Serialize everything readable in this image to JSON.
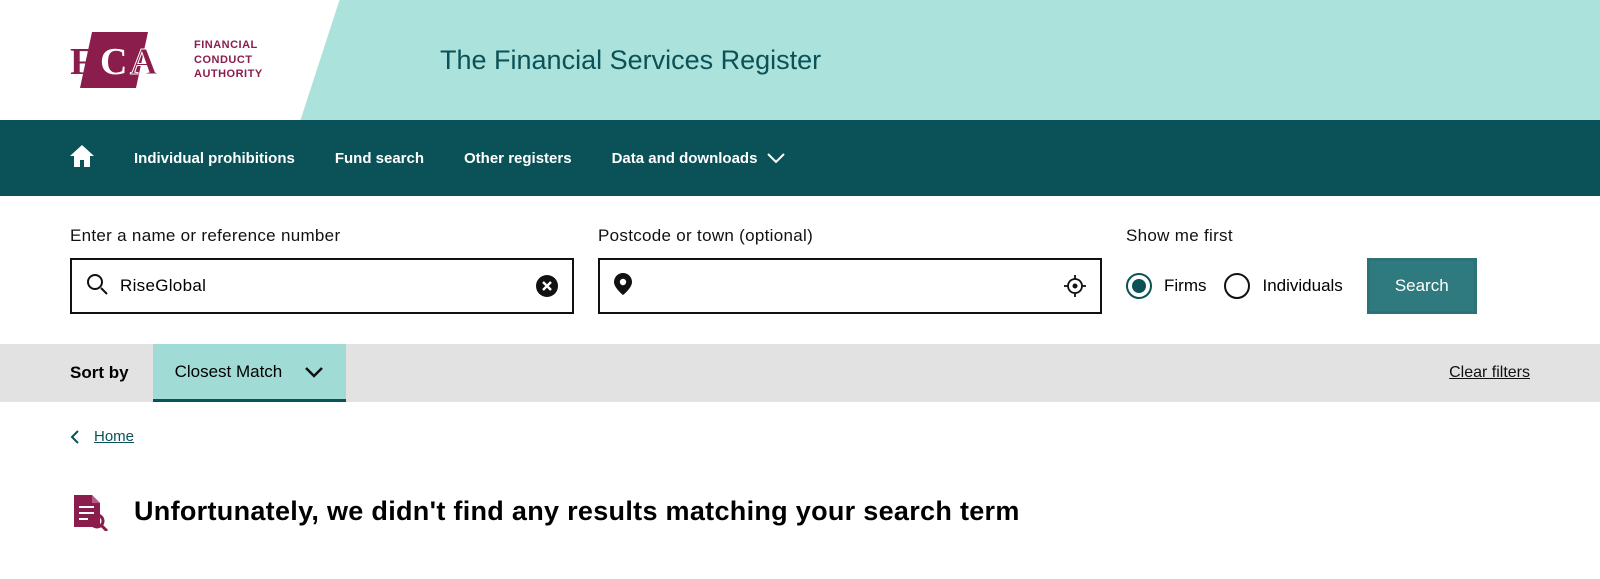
{
  "header": {
    "logo_line1": "FINANCIAL",
    "logo_line2": "CONDUCT",
    "logo_line3": "AUTHORITY",
    "title": "The Financial Services Register"
  },
  "nav": {
    "items": [
      "Individual prohibitions",
      "Fund search",
      "Other registers",
      "Data and downloads"
    ]
  },
  "search": {
    "name_label": "Enter a name or reference number",
    "name_value": "RiseGlobal",
    "postcode_label": "Postcode or town (optional)",
    "postcode_value": "",
    "show_label": "Show me first",
    "radio_firms": "Firms",
    "radio_individuals": "Individuals",
    "selected_radio": "firms",
    "button": "Search"
  },
  "sort": {
    "label": "Sort by",
    "selected": "Closest Match",
    "clear": "Clear filters"
  },
  "breadcrumb": {
    "home": "Home"
  },
  "results": {
    "heading": "Unfortunately, we didn't find any results matching your search term"
  }
}
